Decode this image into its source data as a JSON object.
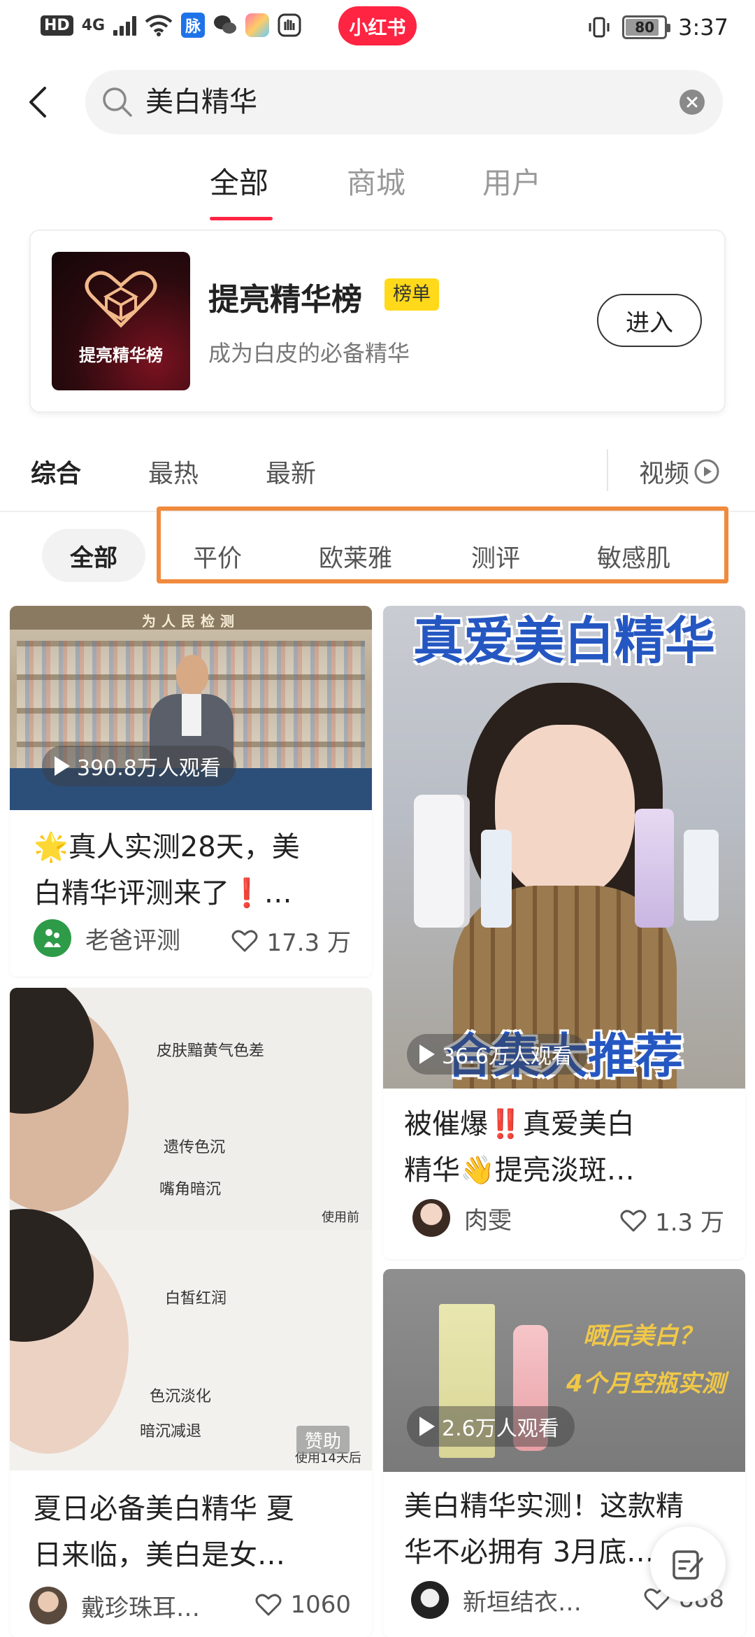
{
  "status_bar": {
    "network_badge": "HD",
    "signal_label": "4G",
    "app_badge_text": "脉",
    "brand_text": "小红书",
    "battery_level": "80",
    "time": "3:37"
  },
  "search": {
    "query": "美白精华"
  },
  "top_tabs": [
    {
      "label": "全部",
      "active": true
    },
    {
      "label": "商城",
      "active": false
    },
    {
      "label": "用户",
      "active": false
    }
  ],
  "ranking_card": {
    "thumb_text": "提亮精华榜",
    "title": "提亮精华榜",
    "badge": "榜单",
    "subtitle": "成为白皮的必备精华",
    "enter_label": "进入"
  },
  "sort_bar": {
    "items": [
      {
        "label": "综合",
        "active": true
      },
      {
        "label": "最热",
        "active": false
      },
      {
        "label": "最新",
        "active": false
      }
    ],
    "video_filter_label": "视频"
  },
  "filter_chips": {
    "all_label": "全部",
    "items": [
      "平价",
      "欧莱雅",
      "测评",
      "敏感肌"
    ]
  },
  "feed": {
    "cards": [
      {
        "views": "390.8万人观看",
        "title_line1": "🌟真人实测28天，美",
        "title_line2": "白精华评测来了❗…",
        "author": "老爸评测",
        "likes": "17.3 万",
        "cover_banner": "为人民检测"
      },
      {
        "cover_title": "真爱美白精华",
        "cover_subtitle": "合集大推荐",
        "views": "36.6万人观看",
        "title_line1": "被催爆‼️真爱美白",
        "title_line2": "精华👋提亮淡斑…",
        "author": "肉雯",
        "likes": "1.3 万"
      },
      {
        "cover_labels": [
          "皮肤黯黄气色差",
          "遗传色沉",
          "嘴角暗沉",
          "使用前",
          "白皙红润",
          "色沉淡化",
          "暗沉减退",
          "使用14天后"
        ],
        "sponsor_tag": "赞助",
        "title_line1": "夏日必备美白精华 夏",
        "title_line2": "日来临，美白是女…",
        "author": "戴珍珠耳…",
        "likes": "1060"
      },
      {
        "cover_lines": [
          "晒后美白？",
          "4个月空瓶实测"
        ],
        "views": "2.6万人观看",
        "title_line1": "美白精华实测！这款精",
        "title_line2": "华不必拥有 3月底…",
        "author": "新垣结衣…",
        "likes": "888"
      }
    ]
  }
}
